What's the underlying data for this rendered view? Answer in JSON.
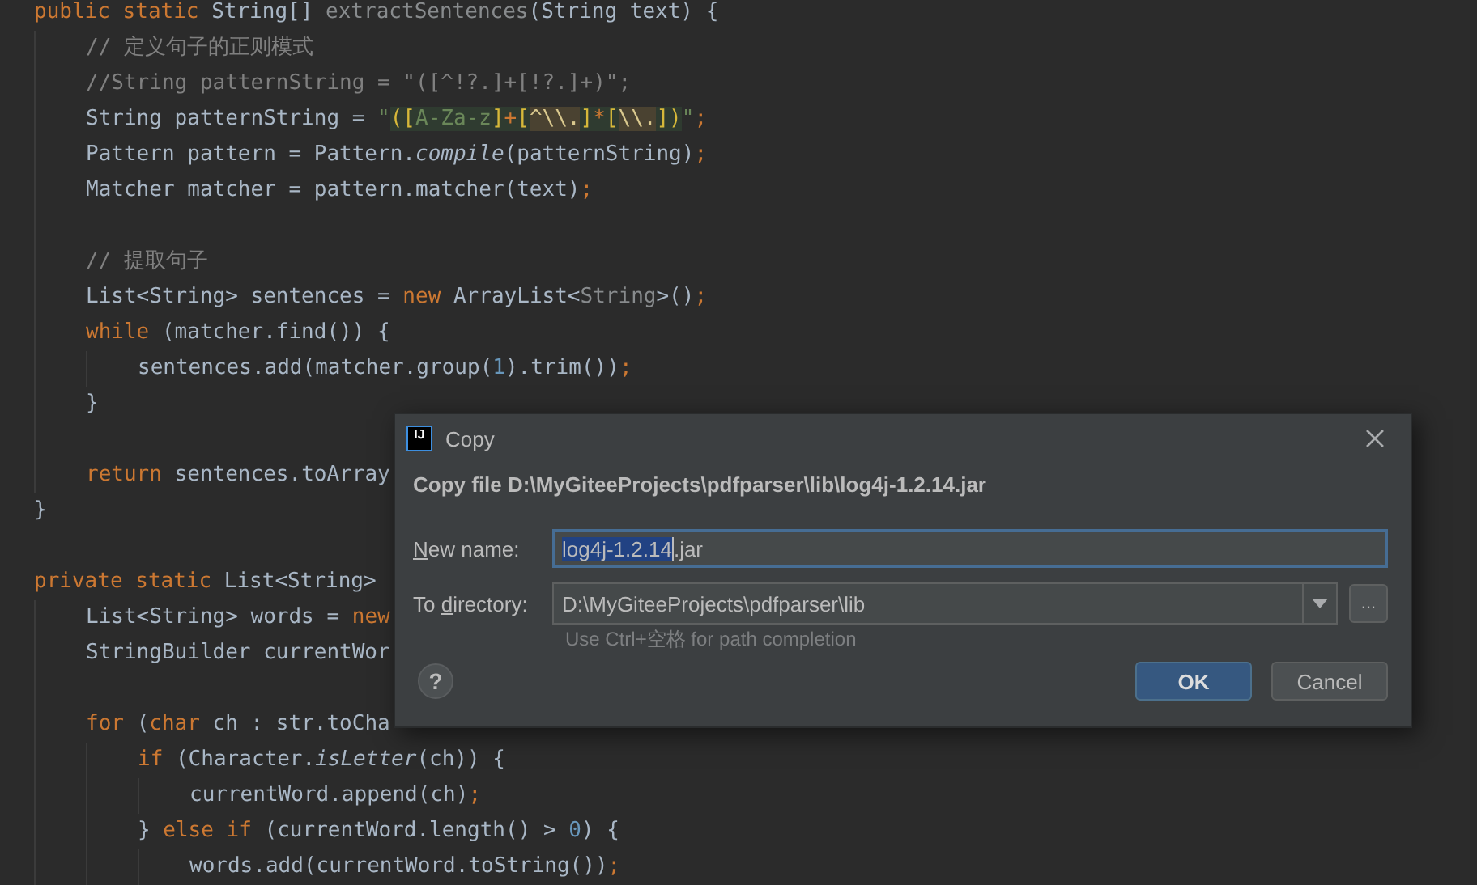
{
  "editor": {
    "lines": [
      {
        "kind": "code",
        "tokens": [
          {
            "kind": "kw",
            "text": "public static "
          },
          {
            "kind": "plain",
            "text": "String[] "
          },
          {
            "kind": "unused",
            "text": "extractSentences"
          },
          {
            "kind": "plain",
            "text": "(String text) {"
          }
        ],
        "children": [
          {
            "kind": "code",
            "tokens": [
              {
                "kind": "comment",
                "text": "// 定义句子的正则模式"
              }
            ]
          },
          {
            "kind": "code",
            "tokens": [
              {
                "kind": "comment",
                "text": "//String patternString = \"([^!?.]+[!?.]+)\";"
              }
            ]
          },
          {
            "kind": "code",
            "tokens": [
              {
                "kind": "plain",
                "text": "String patternString = "
              },
              {
                "kind": "str",
                "text": "\""
              },
              {
                "kind": "rx-brace",
                "text": "(["
              },
              {
                "kind": "rx-text",
                "text": "A-Za-z"
              },
              {
                "kind": "rx-brace",
                "text": "]"
              },
              {
                "kind": "rx-op",
                "text": "+"
              },
              {
                "kind": "rx-brace",
                "text": "["
              },
              {
                "kind": "rx-esc-op",
                "text": "^"
              },
              {
                "kind": "rx-esc",
                "text": "\\\\."
              },
              {
                "kind": "rx-brace",
                "text": "]"
              },
              {
                "kind": "rx-op",
                "text": "*"
              },
              {
                "kind": "rx-brace",
                "text": "["
              },
              {
                "kind": "rx-esc",
                "text": "\\\\."
              },
              {
                "kind": "rx-brace",
                "text": "])"
              },
              {
                "kind": "str",
                "text": "\""
              },
              {
                "kind": "kw",
                "text": ";"
              }
            ]
          },
          {
            "kind": "code",
            "tokens": [
              {
                "kind": "plain",
                "text": "Pattern pattern = Pattern."
              },
              {
                "kind": "italic",
                "text": "compile"
              },
              {
                "kind": "plain",
                "text": "(patternString)"
              },
              {
                "kind": "kw",
                "text": ";"
              }
            ]
          },
          {
            "kind": "code",
            "tokens": [
              {
                "kind": "plain",
                "text": "Matcher matcher = pattern.matcher(text)"
              },
              {
                "kind": "kw",
                "text": ";"
              }
            ]
          },
          {
            "kind": "blank"
          },
          {
            "kind": "code",
            "tokens": [
              {
                "kind": "comment",
                "text": "// 提取句子"
              }
            ]
          },
          {
            "kind": "code",
            "tokens": [
              {
                "kind": "plain",
                "text": "List<String> sentences = "
              },
              {
                "kind": "kw",
                "text": "new "
              },
              {
                "kind": "plain",
                "text": "ArrayList<"
              },
              {
                "kind": "unused",
                "text": "String"
              },
              {
                "kind": "plain",
                "text": ">()"
              },
              {
                "kind": "kw",
                "text": ";"
              }
            ]
          },
          {
            "kind": "code",
            "tokens": [
              {
                "kind": "kw",
                "text": "while "
              },
              {
                "kind": "plain",
                "text": "(matcher.find()) {"
              }
            ],
            "children": [
              {
                "kind": "code",
                "tokens": [
                  {
                    "kind": "plain",
                    "text": "sentences.add(matcher.group("
                  },
                  {
                    "kind": "num",
                    "text": "1"
                  },
                  {
                    "kind": "plain",
                    "text": ").trim())"
                  },
                  {
                    "kind": "kw",
                    "text": ";"
                  }
                ]
              }
            ]
          },
          {
            "kind": "code",
            "tokens": [
              {
                "kind": "plain",
                "text": "}"
              }
            ]
          },
          {
            "kind": "blank"
          },
          {
            "kind": "code",
            "tokens": [
              {
                "kind": "kw",
                "text": "return "
              },
              {
                "kind": "plain",
                "text": "sentences.toArray"
              }
            ]
          }
        ]
      },
      {
        "kind": "code",
        "tokens": [
          {
            "kind": "plain",
            "text": "}"
          }
        ]
      },
      {
        "kind": "blank"
      },
      {
        "kind": "code",
        "tokens": [
          {
            "kind": "kw",
            "text": "private static "
          },
          {
            "kind": "plain",
            "text": "List<String>"
          }
        ],
        "children": [
          {
            "kind": "code",
            "tokens": [
              {
                "kind": "plain",
                "text": "List<String> words = "
              },
              {
                "kind": "kw",
                "text": "new"
              }
            ]
          },
          {
            "kind": "code",
            "tokens": [
              {
                "kind": "plain",
                "text": "StringBuilder currentWor"
              }
            ]
          },
          {
            "kind": "blank"
          },
          {
            "kind": "code",
            "tokens": [
              {
                "kind": "kw",
                "text": "for "
              },
              {
                "kind": "plain",
                "text": "("
              },
              {
                "kind": "kw",
                "text": "char "
              },
              {
                "kind": "plain",
                "text": "ch : str.toCha"
              }
            ],
            "children": [
              {
                "kind": "code",
                "tokens": [
                  {
                    "kind": "kw",
                    "text": "if "
                  },
                  {
                    "kind": "plain",
                    "text": "(Character."
                  },
                  {
                    "kind": "italic",
                    "text": "isLetter"
                  },
                  {
                    "kind": "plain",
                    "text": "(ch)) {"
                  }
                ],
                "children": [
                  {
                    "kind": "code",
                    "tokens": [
                      {
                        "kind": "plain",
                        "text": "currentWord.append(ch)"
                      },
                      {
                        "kind": "kw",
                        "text": ";"
                      }
                    ]
                  }
                ]
              },
              {
                "kind": "code",
                "tokens": [
                  {
                    "kind": "plain",
                    "text": "} "
                  },
                  {
                    "kind": "kw",
                    "text": "else if "
                  },
                  {
                    "kind": "plain",
                    "text": "(currentWord.length() > "
                  },
                  {
                    "kind": "num",
                    "text": "0"
                  },
                  {
                    "kind": "plain",
                    "text": ") {"
                  }
                ],
                "children": [
                  {
                    "kind": "code",
                    "tokens": [
                      {
                        "kind": "plain",
                        "text": "words.add(currentWord.toString())"
                      },
                      {
                        "kind": "kw",
                        "text": ";"
                      }
                    ]
                  }
                ]
              }
            ]
          }
        ]
      }
    ]
  },
  "dialog": {
    "logo_text": "IJ",
    "title": "Copy",
    "heading": "Copy file D:\\MyGiteeProjects\\pdfparser\\lib\\log4j-1.2.14.jar",
    "fields": [
      {
        "kind": "text",
        "mnemonic": "N",
        "label_after": "ew name:",
        "selected_text": "log4j-1.2.14",
        "rest_text": ".jar",
        "focused": true
      },
      {
        "kind": "combo",
        "label_before": "To ",
        "mnemonic": "d",
        "label_after": "irectory:",
        "value": "D:\\MyGiteeProjects\\pdfparser\\lib",
        "browse": "...",
        "focused": false
      }
    ],
    "hint": "Use Ctrl+空格 for path completion",
    "help": "?",
    "buttons": [
      {
        "label": "OK",
        "default": true
      },
      {
        "label": "Cancel",
        "default": false
      }
    ]
  }
}
